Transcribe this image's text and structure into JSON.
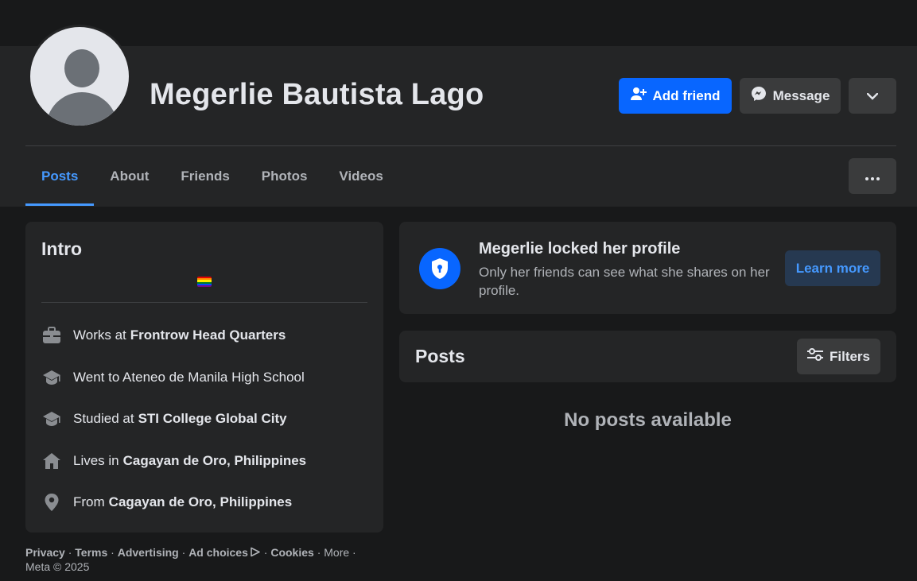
{
  "profile": {
    "name": "Megerlie Bautista Lago",
    "add_friend_label": "Add friend",
    "message_label": "Message"
  },
  "tabs": [
    {
      "label": "Posts",
      "active": true
    },
    {
      "label": "About"
    },
    {
      "label": "Friends"
    },
    {
      "label": "Photos"
    },
    {
      "label": "Videos"
    }
  ],
  "intro": {
    "title": "Intro",
    "items": [
      {
        "icon": "briefcase-icon",
        "prefix": "Works at",
        "value": "Frontrow Head Quarters"
      },
      {
        "icon": "graduation-cap-icon",
        "prefix": "Went to Ateneo de Manila High School",
        "value": ""
      },
      {
        "icon": "graduation-cap-icon",
        "prefix": "Studied at",
        "value": "STI College Global City"
      },
      {
        "icon": "home-icon",
        "prefix": "Lives in",
        "value": "Cagayan de Oro, Philippines"
      },
      {
        "icon": "location-pin-icon",
        "prefix": "From",
        "value": "Cagayan de Oro, Philippines"
      }
    ]
  },
  "locked": {
    "title": "Megerlie locked her profile",
    "description": "Only her friends can see what she shares on her profile.",
    "learn_more_label": "Learn more"
  },
  "posts": {
    "title": "Posts",
    "filters_label": "Filters",
    "empty_text": "No posts available"
  },
  "footer": {
    "links": [
      "Privacy",
      "Terms",
      "Advertising",
      "Ad choices",
      "Cookies"
    ],
    "more": "More",
    "copyright": "Meta © 2025"
  },
  "colors": {
    "accent": "#0866ff",
    "link_active": "#4599ff",
    "card_bg": "#242526",
    "page_bg": "#18191a"
  }
}
